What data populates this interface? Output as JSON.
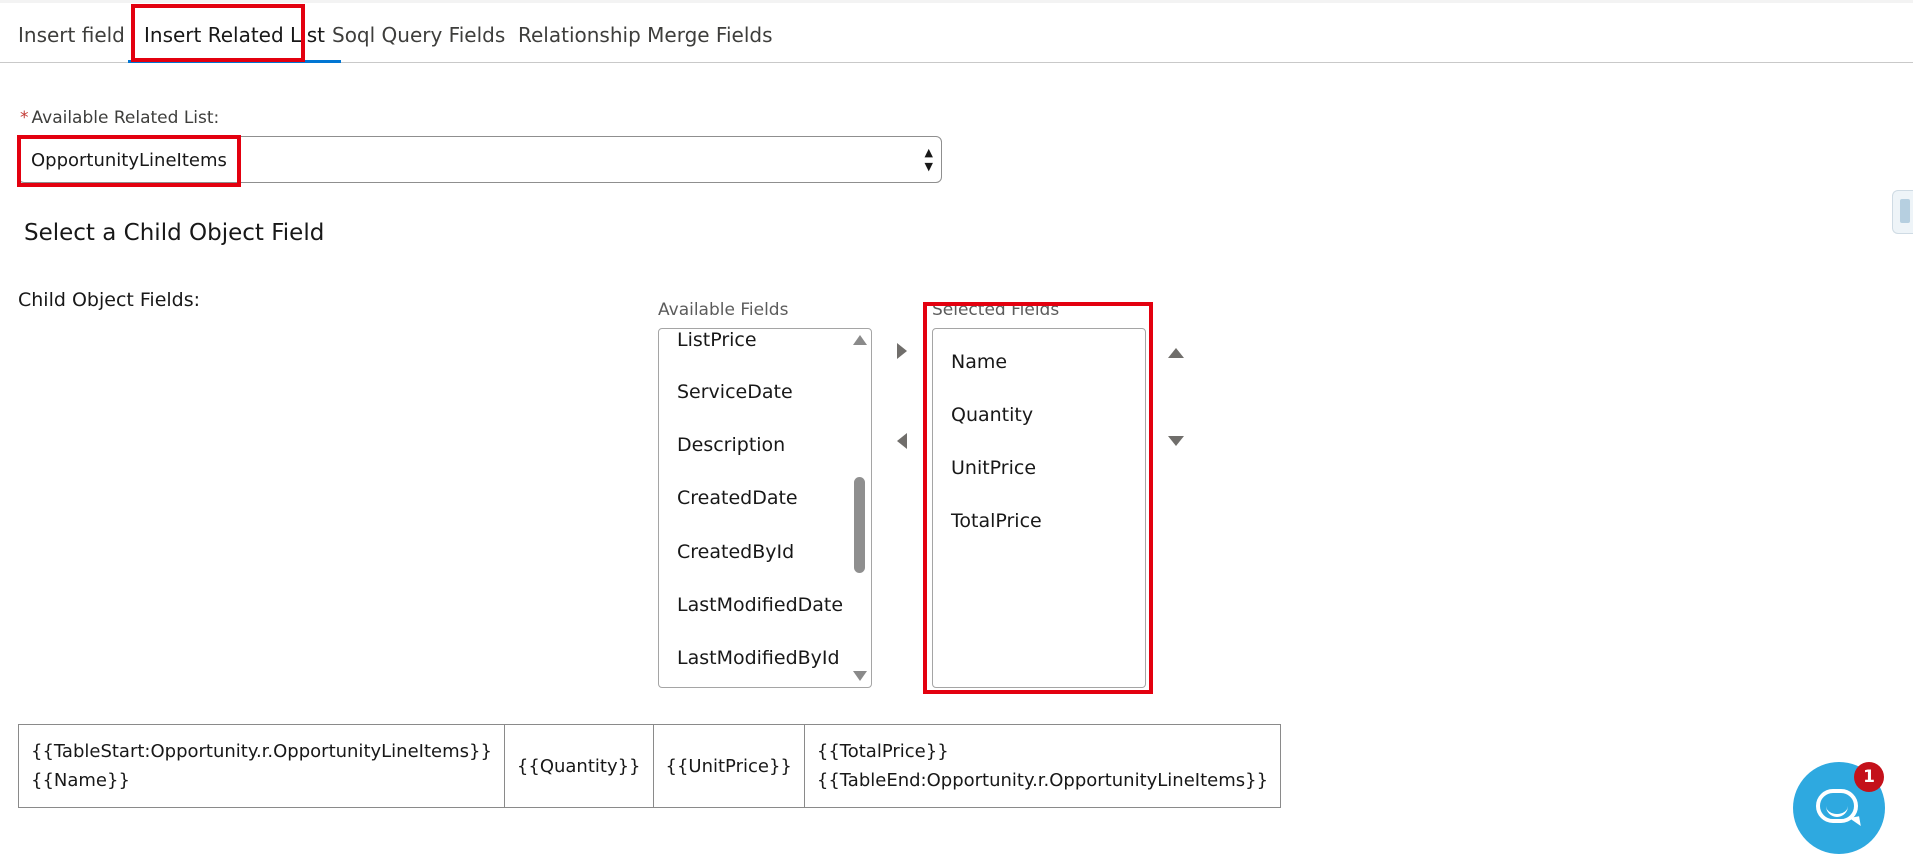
{
  "tabs": [
    {
      "label": "Insert field"
    },
    {
      "label": "Insert Related List"
    },
    {
      "label": "Soql Query Fields"
    },
    {
      "label": "Relationship Merge Fields"
    }
  ],
  "active_tab": "Insert Related List",
  "related_list": {
    "required_marker": "*",
    "label": "Available Related List:",
    "value": "OpportunityLineItems"
  },
  "section_title": "Select a Child Object Field",
  "child_fields_label": "Child Object Fields:",
  "picklist": {
    "available_label": "Available Fields",
    "selected_label": "Selected Fields",
    "available_options": [
      "ListPrice",
      "ServiceDate",
      "Description",
      "CreatedDate",
      "CreatedById",
      "LastModifiedDate",
      "LastModifiedById"
    ],
    "selected_options": [
      "Name",
      "Quantity",
      "UnitPrice",
      "TotalPrice"
    ]
  },
  "merge_table": {
    "cells": [
      {
        "line1": "{{TableStart:Opportunity.r.OpportunityLineItems}}",
        "line2": "{{Name}}"
      },
      {
        "line1": "{{Quantity}}",
        "line2": ""
      },
      {
        "line1": "{{UnitPrice}}",
        "line2": ""
      },
      {
        "line1": "{{TotalPrice}}",
        "line2": "{{TableEnd:Opportunity.r.OpportunityLineItems}}"
      }
    ]
  },
  "chat": {
    "badge_count": "1"
  },
  "colors": {
    "accent": "#0176d3",
    "highlight": "#e3000f",
    "chat": "#2ea9e0",
    "badge": "#c4111a"
  }
}
